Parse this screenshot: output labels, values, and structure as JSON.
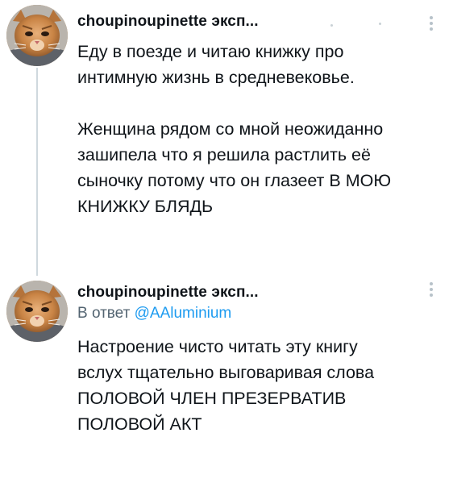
{
  "thread": {
    "tweets": [
      {
        "username": "choupinoupinette эксп...",
        "text": "Еду в поезде и читаю книжку про\nинтимную жизнь в средневековье.\n\nЖенщина рядом со мной неожиданно\nзашипела что я решила растлить её\nсыночку потому что он глазеет В МОЮ\nКНИЖКУ БЛЯДЬ",
        "avatar_icon": "cat-avatar-icon",
        "more_icon": "more-options-icon"
      },
      {
        "username": "choupinoupinette эксп...",
        "reply_prefix": "В ответ ",
        "reply_mention": "@AAluminium",
        "text": "Настроение чисто читать эту книгу\nвслух тщательно выговаривая слова\nПОЛОВОЙ ЧЛЕН ПРЕЗЕРВАТИВ\nПОЛОВОЙ АКТ",
        "avatar_icon": "cat-avatar-icon",
        "more_icon": "more-options-icon"
      }
    ]
  },
  "colors": {
    "text": "#0f1419",
    "secondary": "#536471",
    "link": "#1d9bf0",
    "thread_line": "#cfd9de"
  }
}
